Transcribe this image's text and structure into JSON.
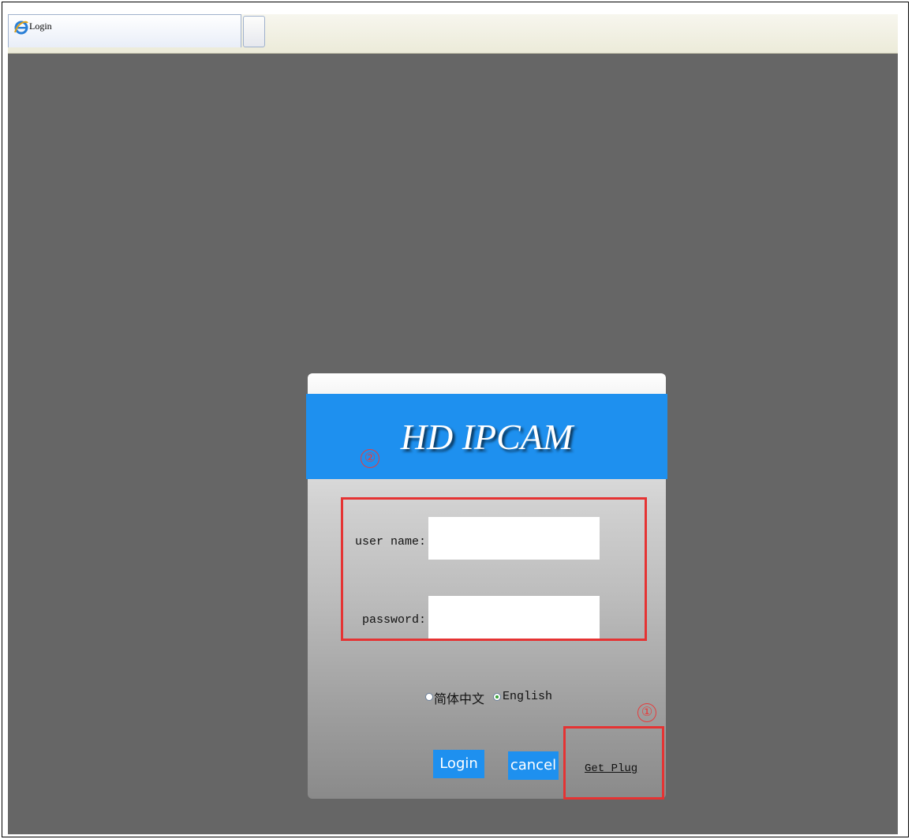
{
  "browser": {
    "tab_title": "Login"
  },
  "login": {
    "brand": "HD IPCAM",
    "username_label": "user name:",
    "username_value": "",
    "password_label": "password:",
    "password_value": "",
    "languages": [
      {
        "label": "简体中文",
        "selected": false
      },
      {
        "label": "English",
        "selected": true
      }
    ],
    "login_button": "Login",
    "cancel_button": "cancel",
    "plugin_link": "Get Plug"
  },
  "annotations": {
    "marker_1": "①",
    "marker_2": "②",
    "highlight_color": "#e53333"
  },
  "colors": {
    "accent": "#1e90ef",
    "background": "#666666"
  }
}
